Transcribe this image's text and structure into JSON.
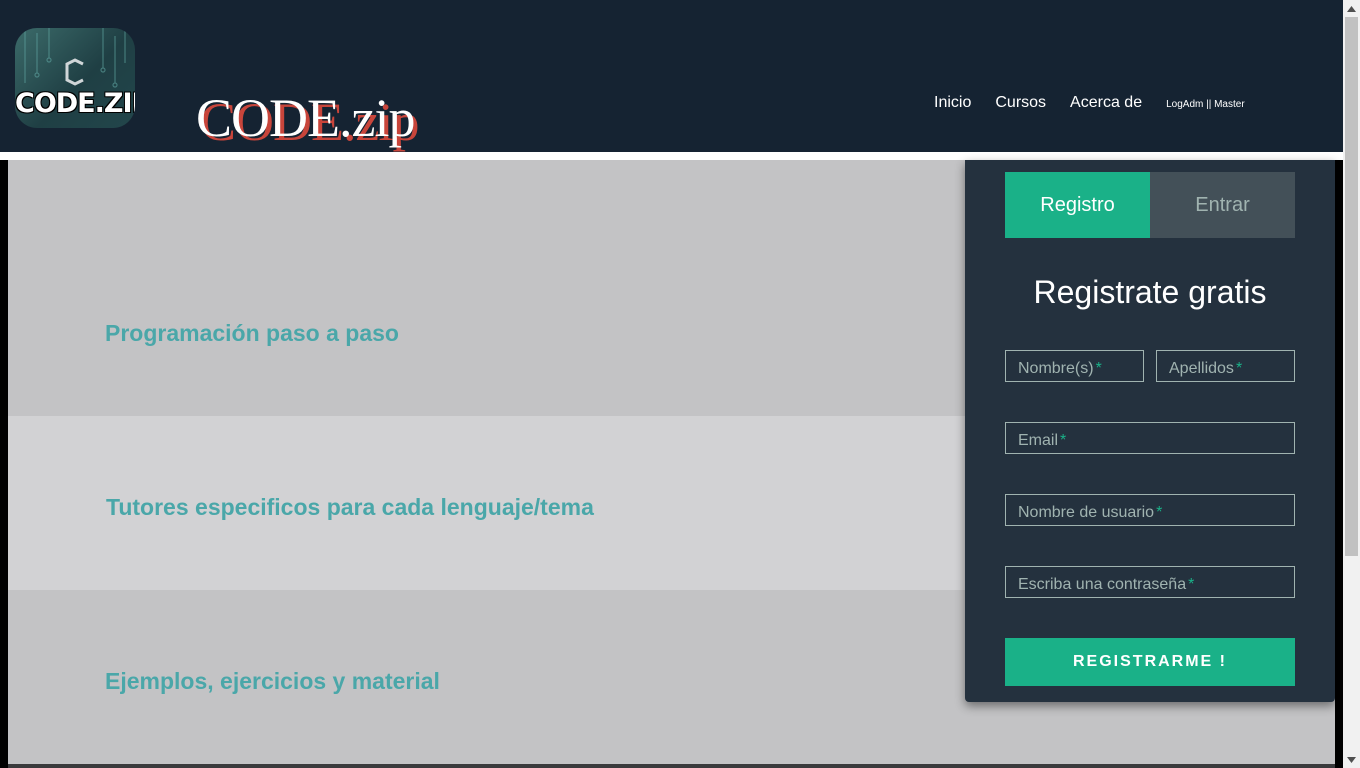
{
  "header": {
    "logo_text": "CODE.ZIP",
    "site_title": "CODE.zip",
    "nav": [
      {
        "label": "Inicio"
      },
      {
        "label": "Cursos"
      },
      {
        "label": "Acerca de"
      },
      {
        "label": "LogAdm || Master"
      }
    ]
  },
  "features": [
    {
      "label": "Programación paso a paso"
    },
    {
      "label": "Tutores especificos para cada lenguaje/tema"
    },
    {
      "label": "Ejemplos, ejercicios y material"
    }
  ],
  "form": {
    "tabs": [
      {
        "label": "Registro",
        "active": true
      },
      {
        "label": "Entrar",
        "active": false
      }
    ],
    "title": "Registrate gratis",
    "fields": {
      "first_name": {
        "placeholder": "Nombre(s)",
        "required_mark": "*"
      },
      "last_name": {
        "placeholder": "Apellidos",
        "required_mark": "*"
      },
      "email": {
        "placeholder": "Email",
        "required_mark": "*"
      },
      "username": {
        "placeholder": "Nombre de usuario",
        "required_mark": "*"
      },
      "password": {
        "placeholder": "Escriba una contraseña",
        "required_mark": "*"
      }
    },
    "submit_label": "REGISTRARME !"
  },
  "colors": {
    "header_bg": "#152332",
    "accent": "#1ab188",
    "panel_bg": "#24313e",
    "feature_text": "#4aa7a9",
    "title_shadow": "#c8453b"
  }
}
